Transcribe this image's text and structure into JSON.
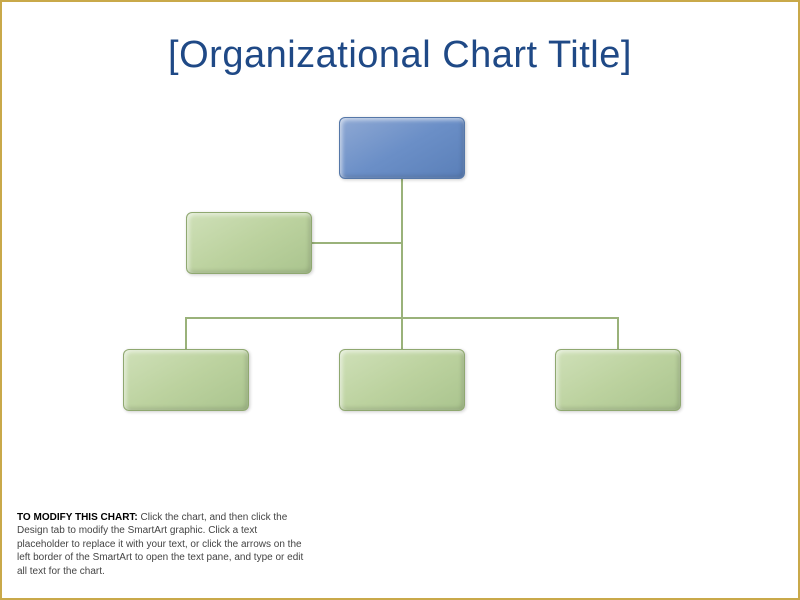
{
  "title": "[Organizational Chart Title]",
  "instruction": {
    "bold_lead": "TO MODIFY THIS CHART:",
    "body": " Click the chart, and then click the Design tab to modify the SmartArt graphic. Click a text placeholder to replace it with your text, or click the  arrows on the left border of the SmartArt to open the text pane, and type or edit all text for the chart."
  },
  "chart_data": {
    "type": "org-chart",
    "nodes": [
      {
        "id": "root",
        "level": 0,
        "color": "blue",
        "label": ""
      },
      {
        "id": "assistant",
        "level": 1,
        "color": "green",
        "is_assistant": true,
        "label": ""
      },
      {
        "id": "child1",
        "level": 2,
        "color": "green",
        "label": ""
      },
      {
        "id": "child2",
        "level": 2,
        "color": "green",
        "label": ""
      },
      {
        "id": "child3",
        "level": 2,
        "color": "green",
        "label": ""
      }
    ],
    "edges": [
      {
        "from": "root",
        "to": "assistant"
      },
      {
        "from": "root",
        "to": "child1"
      },
      {
        "from": "root",
        "to": "child2"
      },
      {
        "from": "root",
        "to": "child3"
      }
    ],
    "colors": {
      "blue": "#6b8fc7",
      "green": "#bcd29f",
      "line": "#9ab27a"
    }
  }
}
